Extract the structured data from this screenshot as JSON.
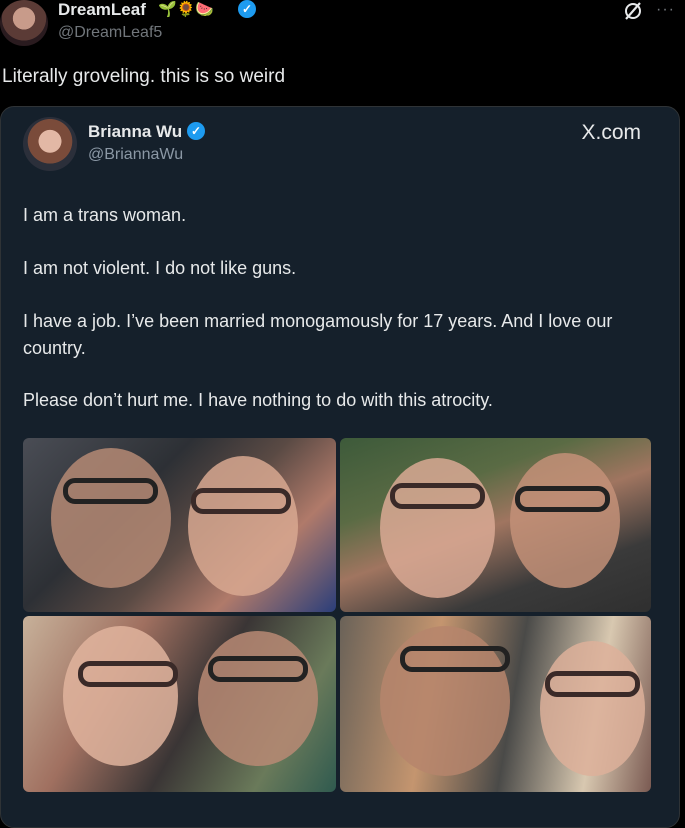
{
  "header": {
    "display_name": "DreamLeaf",
    "name_emojis": "🌱🌻🍉",
    "verified_mark": "✓",
    "handle": "@DreamLeaf5",
    "more_icon": "···"
  },
  "tweet": {
    "text": "Literally groveling. this is so weird"
  },
  "quoted_card": {
    "display_name": "Brianna Wu",
    "verified_mark": "✓",
    "handle": "@BriannaWu",
    "source": "X.com",
    "paragraphs": [
      "I am a trans woman.",
      "I am not violent. I do not like guns.",
      "I have a job. I’ve been married monogamously for 17 years. And I love our country.",
      "Please don’t hurt me. I have nothing to do with this atrocity."
    ]
  },
  "colors": {
    "background": "#000000",
    "card_background": "#15202b",
    "verified_blue": "#1d9bf0",
    "secondary_text": "#71767b"
  }
}
